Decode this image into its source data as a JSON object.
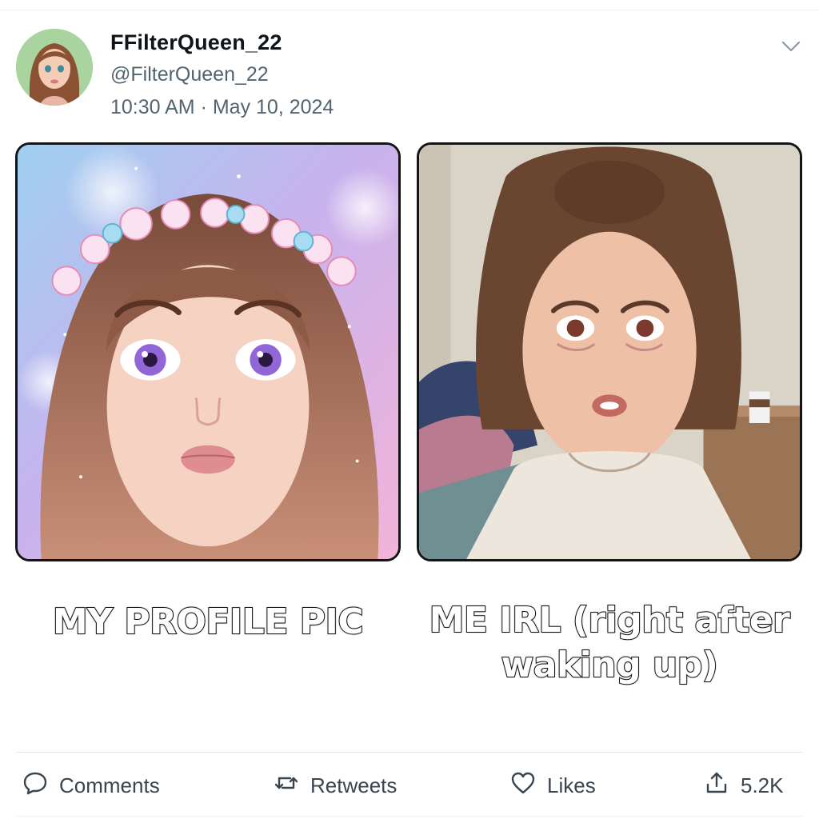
{
  "author": {
    "display_name": "FFilterQueen_22",
    "handle": "@FilterQueen_22",
    "timestamp": "10:30 AM · May 10, 2024"
  },
  "media": {
    "left": {
      "caption": "MY PROFILE PIC"
    },
    "right": {
      "caption": "ME IRL (right after waking up)"
    }
  },
  "actions": {
    "comments_label": "Comments",
    "retweets_label": "Retweets",
    "likes_label": "Likes",
    "share_count": "5.2K"
  },
  "icons": {
    "menu": "chevron-down-icon",
    "comments": "speech-bubble-icon",
    "retweets": "retweet-arrows-icon",
    "likes": "heart-icon",
    "share": "share-upload-icon"
  },
  "colors": {
    "text_primary": "#0f1419",
    "text_secondary": "#536471",
    "divider": "#e3e7ea"
  }
}
